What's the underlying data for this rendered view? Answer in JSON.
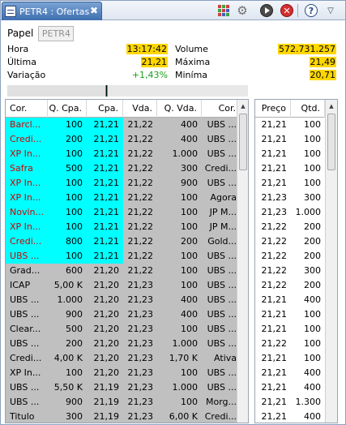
{
  "window": {
    "tab_title": "PETR4 : Ofertas",
    "tab_close": "✖",
    "icons": [
      "grid-icon",
      "gear-icon",
      "play-icon",
      "stop-icon",
      "help-icon",
      "menu-icon"
    ],
    "stop_glyph": "✕",
    "help_glyph": "?",
    "menu_glyph": "▽",
    "gear_glyph": "⚙"
  },
  "header": {
    "papel_label": "Papel",
    "papel_value": "PETR4",
    "hora_label": "Hora",
    "hora_value": "13:17:42",
    "ultima_label": "Última",
    "ultima_value": "21,21",
    "variacao_label": "Variação",
    "variacao_value": "+1,43%",
    "volume_label": "Volume",
    "volume_value": "572.731.257",
    "maxima_label": "Máxima",
    "maxima_value": "21,49",
    "minima_label": "Miníma",
    "minima_value": "20,71"
  },
  "colors": {
    "highlight": "#ffd700",
    "buy_top": "#00ffff",
    "broker_red": "#d00000",
    "positive": "#1aa01a",
    "book_bg": "#c0c0c0"
  },
  "book": {
    "columns": [
      "Cor.",
      "Q. Cpa.",
      "Cpa.",
      "Vda.",
      "Q. Vda.",
      "Cor."
    ],
    "rows": [
      {
        "hot": true,
        "buy_broker": "Barcl...",
        "buy_qty": "100",
        "buy_price": "21,21",
        "sell_price": "21,22",
        "sell_qty": "400",
        "sell_broker": "UBS ..."
      },
      {
        "hot": true,
        "buy_broker": "Credi...",
        "buy_qty": "200",
        "buy_price": "21,21",
        "sell_price": "21,22",
        "sell_qty": "400",
        "sell_broker": "UBS ..."
      },
      {
        "hot": true,
        "buy_broker": "XP In...",
        "buy_qty": "100",
        "buy_price": "21,21",
        "sell_price": "21,22",
        "sell_qty": "1.000",
        "sell_broker": "UBS ..."
      },
      {
        "hot": true,
        "buy_broker": "Safra",
        "buy_qty": "500",
        "buy_price": "21,21",
        "sell_price": "21,22",
        "sell_qty": "300",
        "sell_broker": "Credi..."
      },
      {
        "hot": true,
        "buy_broker": "XP In...",
        "buy_qty": "100",
        "buy_price": "21,21",
        "sell_price": "21,22",
        "sell_qty": "900",
        "sell_broker": "UBS ..."
      },
      {
        "hot": true,
        "buy_broker": "XP In...",
        "buy_qty": "100",
        "buy_price": "21,21",
        "sell_price": "21,22",
        "sell_qty": "100",
        "sell_broker": "Agora"
      },
      {
        "hot": true,
        "buy_broker": "Novin...",
        "buy_qty": "100",
        "buy_price": "21,21",
        "sell_price": "21,22",
        "sell_qty": "100",
        "sell_broker": "JP M..."
      },
      {
        "hot": true,
        "buy_broker": "XP In...",
        "buy_qty": "100",
        "buy_price": "21,21",
        "sell_price": "21,22",
        "sell_qty": "100",
        "sell_broker": "JP M..."
      },
      {
        "hot": true,
        "buy_broker": "Credi...",
        "buy_qty": "800",
        "buy_price": "21,21",
        "sell_price": "21,22",
        "sell_qty": "200",
        "sell_broker": "Gold..."
      },
      {
        "hot": true,
        "buy_broker": "UBS ...",
        "buy_qty": "100",
        "buy_price": "21,21",
        "sell_price": "21,22",
        "sell_qty": "100",
        "sell_broker": "UBS ..."
      },
      {
        "hot": false,
        "buy_broker": "Grad...",
        "buy_qty": "600",
        "buy_price": "21,20",
        "sell_price": "21,22",
        "sell_qty": "100",
        "sell_broker": "UBS ..."
      },
      {
        "hot": false,
        "buy_broker": "ICAP",
        "buy_qty": "5,00 K",
        "buy_price": "21,20",
        "sell_price": "21,23",
        "sell_qty": "100",
        "sell_broker": "UBS ..."
      },
      {
        "hot": false,
        "buy_broker": "UBS ...",
        "buy_qty": "1.000",
        "buy_price": "21,20",
        "sell_price": "21,23",
        "sell_qty": "400",
        "sell_broker": "UBS ..."
      },
      {
        "hot": false,
        "buy_broker": "UBS ...",
        "buy_qty": "900",
        "buy_price": "21,20",
        "sell_price": "21,23",
        "sell_qty": "400",
        "sell_broker": "UBS ..."
      },
      {
        "hot": false,
        "buy_broker": "Clear...",
        "buy_qty": "500",
        "buy_price": "21,20",
        "sell_price": "21,23",
        "sell_qty": "100",
        "sell_broker": "UBS ..."
      },
      {
        "hot": false,
        "buy_broker": "UBS ...",
        "buy_qty": "200",
        "buy_price": "21,20",
        "sell_price": "21,23",
        "sell_qty": "1.000",
        "sell_broker": "UBS ..."
      },
      {
        "hot": false,
        "buy_broker": "Credi...",
        "buy_qty": "4,00 K",
        "buy_price": "21,20",
        "sell_price": "21,23",
        "sell_qty": "1,70 K",
        "sell_broker": "Ativa"
      },
      {
        "hot": false,
        "buy_broker": "XP In...",
        "buy_qty": "100",
        "buy_price": "21,20",
        "sell_price": "21,23",
        "sell_qty": "100",
        "sell_broker": "UBS ..."
      },
      {
        "hot": false,
        "buy_broker": "UBS ...",
        "buy_qty": "5,50 K",
        "buy_price": "21,19",
        "sell_price": "21,23",
        "sell_qty": "1.000",
        "sell_broker": "UBS ..."
      },
      {
        "hot": false,
        "buy_broker": "UBS ...",
        "buy_qty": "900",
        "buy_price": "21,19",
        "sell_price": "21,23",
        "sell_qty": "100",
        "sell_broker": "Morg..."
      },
      {
        "hot": false,
        "buy_broker": "Titulo",
        "buy_qty": "300",
        "buy_price": "21,19",
        "sell_price": "21,23",
        "sell_qty": "6,00 K",
        "sell_broker": "Credi..."
      }
    ]
  },
  "trades": {
    "columns": [
      "Preço",
      "Qtd."
    ],
    "rows": [
      {
        "price": "21,21",
        "qty": "100"
      },
      {
        "price": "21,21",
        "qty": "100"
      },
      {
        "price": "21,21",
        "qty": "100"
      },
      {
        "price": "21,21",
        "qty": "100"
      },
      {
        "price": "21,21",
        "qty": "100"
      },
      {
        "price": "21,23",
        "qty": "300"
      },
      {
        "price": "21,23",
        "qty": "1.000"
      },
      {
        "price": "21,22",
        "qty": "200"
      },
      {
        "price": "21,22",
        "qty": "200"
      },
      {
        "price": "21,22",
        "qty": "200"
      },
      {
        "price": "21,22",
        "qty": "300"
      },
      {
        "price": "21,22",
        "qty": "200"
      },
      {
        "price": "21,21",
        "qty": "400"
      },
      {
        "price": "21,21",
        "qty": "100"
      },
      {
        "price": "21,21",
        "qty": "100"
      },
      {
        "price": "21,22",
        "qty": "100"
      },
      {
        "price": "21,21",
        "qty": "100"
      },
      {
        "price": "21,21",
        "qty": "400"
      },
      {
        "price": "21,21",
        "qty": "400"
      },
      {
        "price": "21,21",
        "qty": "1.300"
      },
      {
        "price": "21,21",
        "qty": "400"
      }
    ]
  }
}
